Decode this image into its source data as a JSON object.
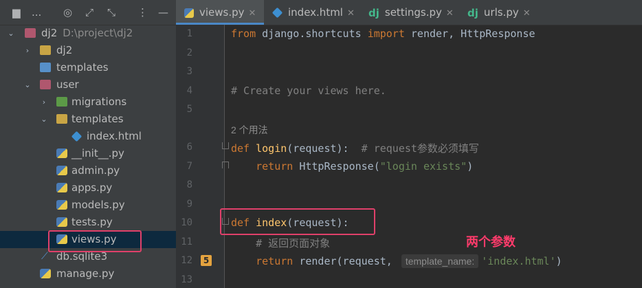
{
  "project_toolbar": {
    "title": "..."
  },
  "tree": {
    "root": {
      "name": "dj2",
      "path": "D:\\project\\dj2"
    },
    "items": [
      {
        "label": "dj2"
      },
      {
        "label": "templates"
      },
      {
        "label": "user"
      },
      {
        "label": "migrations"
      },
      {
        "label": "templates"
      },
      {
        "label": "index.html"
      },
      {
        "label": "__init__.py"
      },
      {
        "label": "admin.py"
      },
      {
        "label": "apps.py"
      },
      {
        "label": "models.py"
      },
      {
        "label": "tests.py"
      },
      {
        "label": "views.py"
      },
      {
        "label": "db.sqlite3"
      },
      {
        "label": "manage.py"
      }
    ]
  },
  "tabs": [
    {
      "label": "views.py"
    },
    {
      "label": "index.html"
    },
    {
      "label": "settings.py"
    },
    {
      "label": "urls.py"
    }
  ],
  "editor": {
    "usage_hint": "2 个用法",
    "line_numbers": [
      "1",
      "2",
      "3",
      "4",
      "5",
      "6",
      "7",
      "8",
      "9",
      "10",
      "11",
      "12",
      "13"
    ],
    "code": {
      "l1_from": "from",
      "l1_mod": " django.shortcuts ",
      "l1_import": "import",
      "l1_rest": " render, HttpResponse",
      "l4_comment": "# Create your views here.",
      "l6_def": "def",
      "l6_name": "login",
      "l6_args": "(request):",
      "l6_comment": "  # request参数必须填写",
      "l7_return": "return",
      "l7_call": " HttpResponse(",
      "l7_str": "\"login exists\"",
      "l7_end": ")",
      "l10_def": "def",
      "l10_name": "index",
      "l10_args": "(request):",
      "l11_comment": "# 返回页面对象",
      "l12_return": "return",
      "l12_call": " render(request,",
      "l12_inlay": "template_name:",
      "l12_str": "'index.html'",
      "l12_end": ")"
    },
    "annotation": "两个参数"
  },
  "colors": {
    "annotation": "#ff3b6b",
    "keyword": "#cc7832",
    "function": "#ffc66d",
    "string": "#6a8759",
    "comment": "#808080"
  }
}
